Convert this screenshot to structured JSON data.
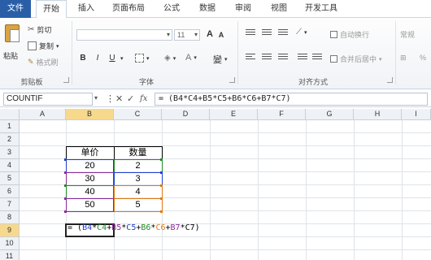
{
  "tabs": [
    {
      "label": "文件",
      "name": "tab-file"
    },
    {
      "label": "开始",
      "name": "tab-home"
    },
    {
      "label": "插入",
      "name": "tab-insert"
    },
    {
      "label": "页面布局",
      "name": "tab-page-layout"
    },
    {
      "label": "公式",
      "name": "tab-formulas"
    },
    {
      "label": "数据",
      "name": "tab-data"
    },
    {
      "label": "审阅",
      "name": "tab-review"
    },
    {
      "label": "视图",
      "name": "tab-view"
    },
    {
      "label": "开发工具",
      "name": "tab-developer"
    }
  ],
  "ribbon": {
    "clipboard": {
      "paste_label": "粘贴",
      "cut_label": "剪切",
      "copy_label": "复制",
      "format_painter_label": "格式刷",
      "group_label": "剪贴板"
    },
    "font": {
      "font_size": "11",
      "bold": "B",
      "italic": "I",
      "underline": "U",
      "grow": "A",
      "shrink": "A",
      "color_a": "A",
      "wen": "變",
      "group_label": "字体"
    },
    "alignment": {
      "wrap_label": "自动换行",
      "merge_label": "合并后居中",
      "group_label": "对齐方式"
    },
    "number": {
      "format_label": "常规",
      "percent": "%"
    }
  },
  "formula_bar": {
    "name_box": "COUNTIF",
    "cancel": "✕",
    "enter": "✓",
    "fx": "fx",
    "formula": "= (B4*C4+B5*C5+B6*C6+B7*C7)"
  },
  "grid": {
    "columns": [
      "A",
      "B",
      "C",
      "D",
      "E",
      "F",
      "G",
      "H",
      "I"
    ],
    "rows": [
      "1",
      "2",
      "3",
      "4",
      "5",
      "6",
      "7",
      "8",
      "9",
      "10",
      "11"
    ],
    "headers": {
      "B3": "单价",
      "C3": "数量"
    },
    "values": {
      "B": [
        "20",
        "30",
        "40",
        "50"
      ],
      "C": [
        "2",
        "3",
        "4",
        "5"
      ]
    }
  },
  "edit_text": [
    {
      "text": "= (",
      "color": "#000000"
    },
    {
      "text": "B4",
      "color": "#1f3fd0"
    },
    {
      "text": "*",
      "color": "#000000"
    },
    {
      "text": "C4",
      "color": "#1f8a2a"
    },
    {
      "text": "+",
      "color": "#000000"
    },
    {
      "text": "B5",
      "color": "#8a2a9b"
    },
    {
      "text": "*",
      "color": "#000000"
    },
    {
      "text": "C5",
      "color": "#1f3fd0"
    },
    {
      "text": "+",
      "color": "#000000"
    },
    {
      "text": "B6",
      "color": "#1f8a2a"
    },
    {
      "text": "*",
      "color": "#000000"
    },
    {
      "text": "C6",
      "color": "#e07a10"
    },
    {
      "text": "+",
      "color": "#000000"
    },
    {
      "text": "B7",
      "color": "#8a2a9b"
    },
    {
      "text": "*C7)",
      "color": "#000000"
    }
  ],
  "colors": {
    "file_tab": "#2a5fa8",
    "selected_header": "#f7d98d",
    "ref_blue": "#1f3fd0",
    "ref_green": "#1f8a2a",
    "ref_purple": "#8a2a9b",
    "ref_orange": "#e07a10"
  }
}
